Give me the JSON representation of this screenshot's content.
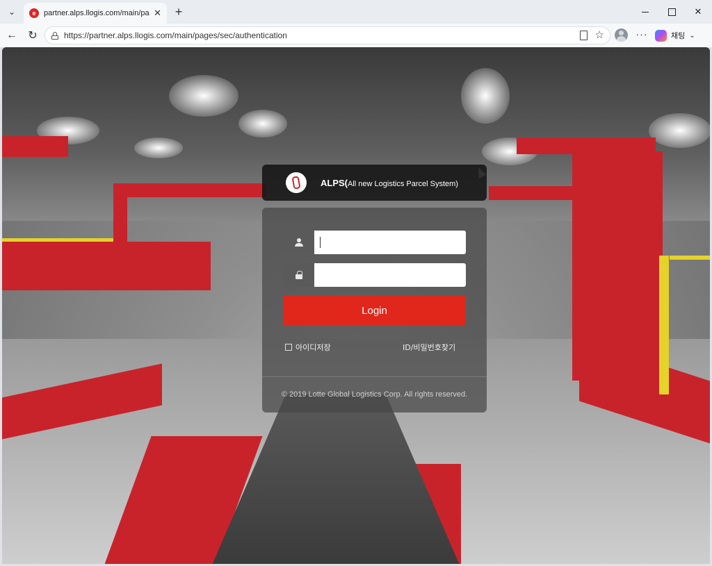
{
  "browser": {
    "tab_title": "partner.alps.llogis.com/main/pages/sec/authentication",
    "url": "https://partner.alps.llogis.com/main/pages/sec/authentication",
    "copilot_label": "채팅"
  },
  "login": {
    "brand": "ALPS",
    "brand_sub_prefix": "(",
    "brand_sub": "All new Logistics Parcel System)",
    "username_value": "",
    "password_value": "",
    "login_button": "Login",
    "remember_label": "아이디저장",
    "find_link": "ID/비밀번호찾기",
    "copyright": "© 2019 Lotte Global Logistics Corp. All rights reserved."
  },
  "colors": {
    "login_button": "#e1261c",
    "brand_red": "#c8232b"
  },
  "icons": {
    "username": "user-icon",
    "password": "lock-icon"
  }
}
